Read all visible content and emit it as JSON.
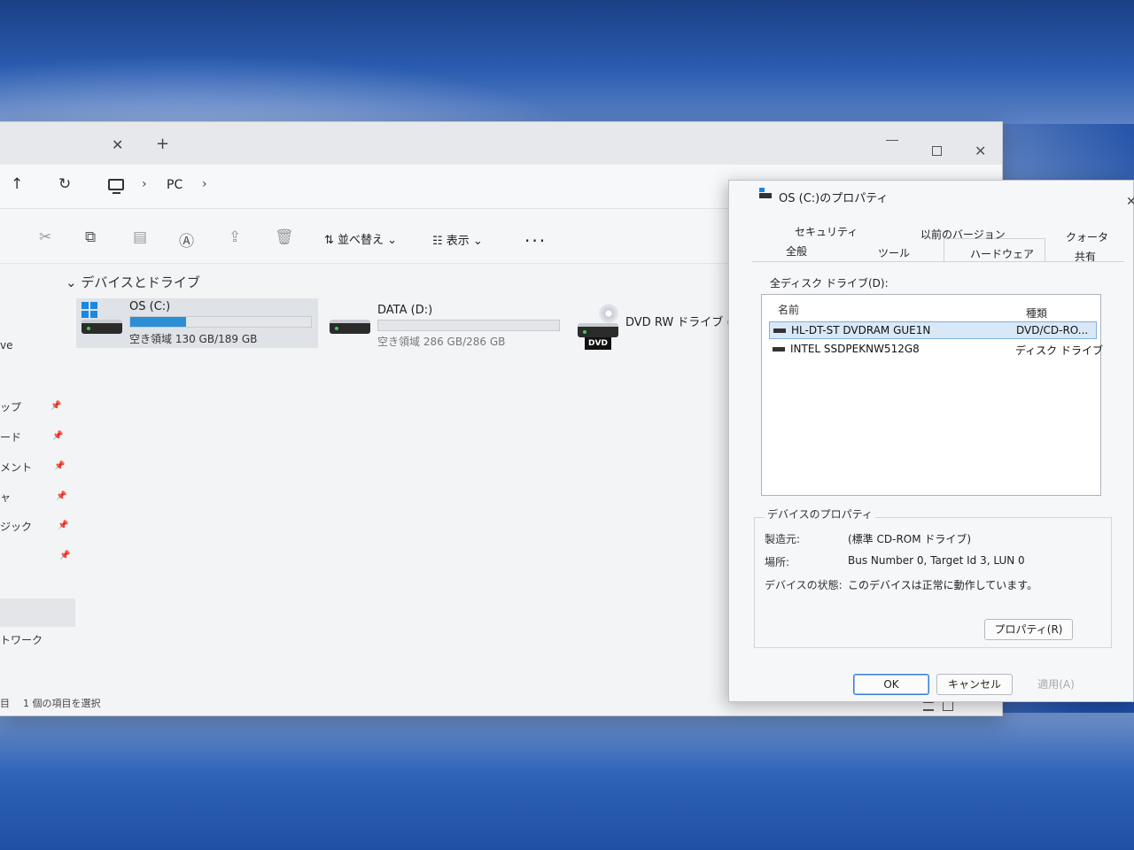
{
  "explorer": {
    "breadcrumb": {
      "location": "PC",
      "sep1": "›",
      "sep2": "›"
    },
    "icons": {
      "close_tab": "✕",
      "new_tab": "+",
      "up": "↑",
      "refresh": "↻",
      "close_window": "✕"
    },
    "toolbar": {
      "sort_label": "⇅ 並べ替え ⌄",
      "view_label": "☷ 表示 ⌄",
      "more": "..."
    },
    "section_title": "⌄ デバイスとドライブ",
    "drives": [
      {
        "name": "OS (C:)",
        "free_text": "空き領域 130 GB/189 GB",
        "used_ratio": 0.31
      },
      {
        "name": "DATA (D:)",
        "free_text": "空き領域 286 GB/286 GB",
        "used_ratio": 0.0
      },
      {
        "name": "DVD RW ドライブ (E:)",
        "disc_label": "DVD"
      }
    ],
    "sidebar_partial": [
      "ve",
      "ップ",
      "ード",
      "メント",
      "ャ",
      "ジック",
      "トワーク"
    ],
    "status_left": "目",
    "status": "1 個の項目を選択"
  },
  "dialog": {
    "title": "OS (C:)のプロパティ",
    "close": "✕",
    "tabs_row1": [
      "セキュリティ",
      "以前のバージョン",
      "クォータ"
    ],
    "tabs_row2": [
      "全般",
      "ツール",
      "ハードウェア",
      "共有"
    ],
    "active_tab": "ハードウェア",
    "list_label": "全ディスク ドライブ(D):",
    "columns": {
      "name": "名前",
      "type": "種類"
    },
    "rows": [
      {
        "name": "HL-DT-ST DVDRAM GUE1N",
        "type": "DVD/CD-RO..."
      },
      {
        "name": "INTEL SSDPEKNW512G8",
        "type": "ディスク ドライブ"
      }
    ],
    "group_title": "デバイスのプロパティ",
    "props": [
      {
        "key": "製造元:",
        "value": "(標準 CD-ROM ドライブ)"
      },
      {
        "key": "場所:",
        "value": "Bus Number 0, Target Id 3, LUN 0"
      },
      {
        "key": "デバイスの状態:",
        "value": "このデバイスは正常に動作しています。"
      }
    ],
    "properties_button": "プロパティ(R)",
    "ok": "OK",
    "cancel": "キャンセル",
    "apply": "適用(A)"
  },
  "colors": {
    "accent": "#2b8fd6",
    "desktop": "#1f4fa6"
  }
}
